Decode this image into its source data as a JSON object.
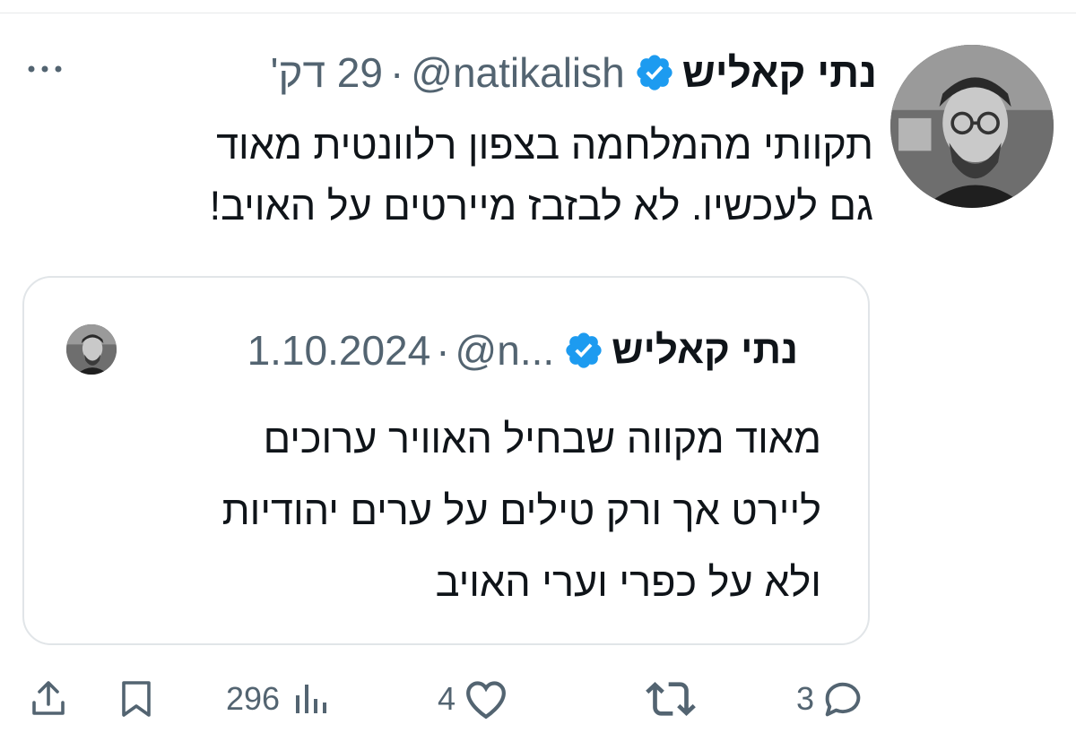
{
  "tweet": {
    "author_name": "נתי קאליש",
    "handle": "@natikalish",
    "separator": "·",
    "time": "29 דק'",
    "text": "תקוותי מהמלחמה בצפון רלוונטית מאוד\nגם לעכשיו. לא לבזבז מיירטים על האויב!"
  },
  "quote": {
    "author_name": "נתי קאליש",
    "handle": "@n...",
    "separator": "·",
    "date": "1.10.2024",
    "text": "מאוד מקווה שבחיל האוויר ערוכים\nליירט אך ורק טילים על ערים יהודיות\nולא על כפרי וערי האויב"
  },
  "actions": {
    "replies": "3",
    "retweets": "",
    "likes": "4",
    "views": "296"
  },
  "icons": {
    "verified": "verified-badge-icon",
    "more": "more-dots-icon",
    "reply": "reply-bubble-icon",
    "retweet": "retweet-icon",
    "like": "heart-icon",
    "views": "analytics-bars-icon",
    "bookmark": "bookmark-icon",
    "share": "share-icon"
  },
  "colors": {
    "verified_blue": "#1d9bf0",
    "secondary_text": "#536471",
    "primary_text": "#0f1419",
    "border": "#e1e5e8"
  }
}
